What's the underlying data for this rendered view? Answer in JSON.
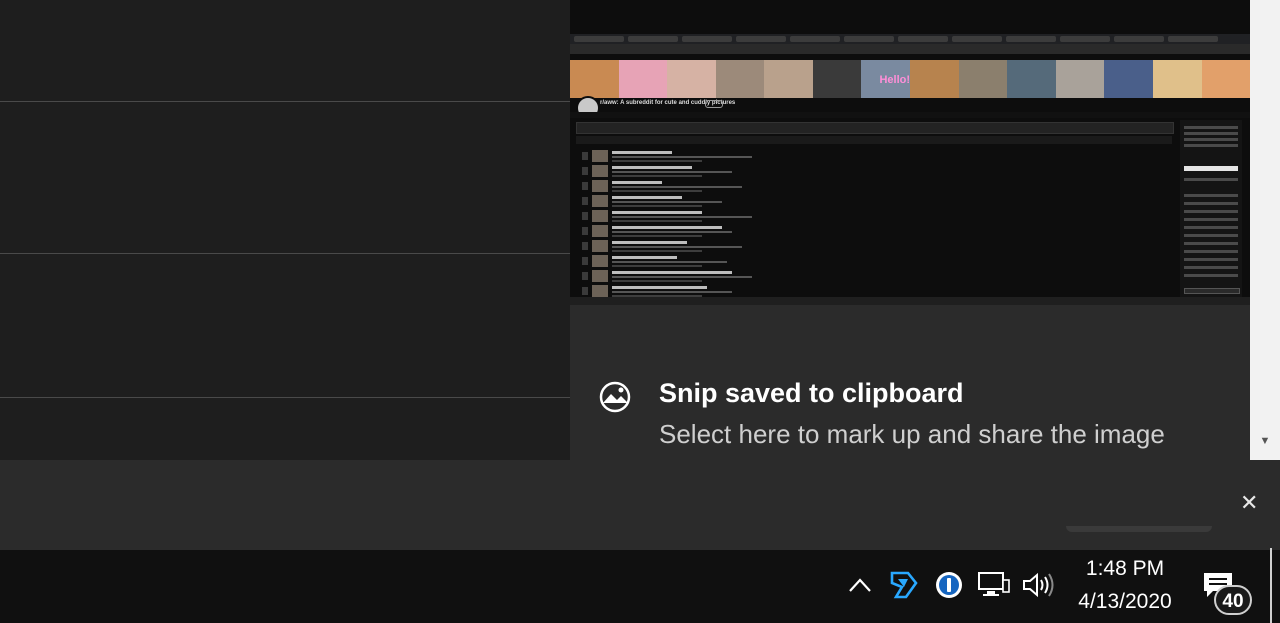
{
  "toast": {
    "title": "Snip saved to clipboard",
    "body": "Select here to mark up and share the image",
    "icon": "snip-sketch-icon",
    "close_glyph": "✕"
  },
  "thumbnail": {
    "subreddit_title": "r/aww: A subreddit for cute and cuddly pictures",
    "banner_text": "Hello!"
  },
  "taskbar": {
    "time": "1:48 PM",
    "date": "4/13/2020",
    "notification_count": "40",
    "tray_icons": [
      "chevron-up-icon",
      "app-icon",
      "password-manager-icon",
      "network-icon",
      "volume-icon"
    ]
  },
  "colors": {
    "toast_bg": "#2b2b2b",
    "taskbar_bg": "#101010",
    "accent": "#1e88e5"
  }
}
